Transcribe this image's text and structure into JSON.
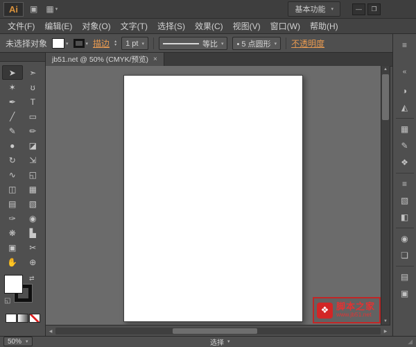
{
  "titlebar": {
    "app_logo": "Ai",
    "bridge_icon": "▣",
    "arrange_icon": "▦",
    "caret": "▾",
    "workspace_label": "基本功能",
    "minimize": "—",
    "restore": "❐"
  },
  "menubar": {
    "items": [
      "文件(F)",
      "编辑(E)",
      "对象(O)",
      "文字(T)",
      "选择(S)",
      "效果(C)",
      "视图(V)",
      "窗口(W)",
      "帮助(H)"
    ]
  },
  "controlbar": {
    "selection_status": "未选择对象",
    "caret": "▾",
    "stroke_link": "描边",
    "spin_up": "▴",
    "spin_down": "▾",
    "stroke_width": "1 pt",
    "profile_label": "等比",
    "brush_label": "• 5 点圆形",
    "opacity_link": "不透明度"
  },
  "tabbar": {
    "doc_title": "jb51.net @ 50% (CMYK/预览)",
    "close": "×"
  },
  "tools": [
    {
      "name": "selection",
      "glyph": "➤"
    },
    {
      "name": "direct-selection",
      "glyph": "➣"
    },
    {
      "name": "magic-wand",
      "glyph": "✶"
    },
    {
      "name": "lasso",
      "glyph": "ʊ"
    },
    {
      "name": "pen",
      "glyph": "✒"
    },
    {
      "name": "type",
      "glyph": "T"
    },
    {
      "name": "line-segment",
      "glyph": "╱"
    },
    {
      "name": "rectangle",
      "glyph": "▭"
    },
    {
      "name": "paintbrush",
      "glyph": "✎"
    },
    {
      "name": "pencil",
      "glyph": "✏"
    },
    {
      "name": "blob-brush",
      "glyph": "●"
    },
    {
      "name": "eraser",
      "glyph": "◪"
    },
    {
      "name": "rotate",
      "glyph": "↻"
    },
    {
      "name": "scale",
      "glyph": "⇲"
    },
    {
      "name": "width",
      "glyph": "∿"
    },
    {
      "name": "free-transform",
      "glyph": "◱"
    },
    {
      "name": "shape-builder",
      "glyph": "◫"
    },
    {
      "name": "perspective-grid",
      "glyph": "▦"
    },
    {
      "name": "mesh",
      "glyph": "▤"
    },
    {
      "name": "gradient",
      "glyph": "▧"
    },
    {
      "name": "eyedropper",
      "glyph": "✑"
    },
    {
      "name": "blend",
      "glyph": "◉"
    },
    {
      "name": "symbol-sprayer",
      "glyph": "❋"
    },
    {
      "name": "column-graph",
      "glyph": "▙"
    },
    {
      "name": "artboard",
      "glyph": "▣"
    },
    {
      "name": "slice",
      "glyph": "✂"
    },
    {
      "name": "hand",
      "glyph": "✋"
    },
    {
      "name": "zoom",
      "glyph": "⊕"
    }
  ],
  "swatches": {
    "swap": "⇄",
    "default": "◱"
  },
  "dock": {
    "panel_menu": "≡",
    "collapse": "«",
    "icons": [
      {
        "name": "color",
        "glyph": "◑"
      },
      {
        "name": "color-guide",
        "glyph": "◭"
      },
      {
        "name": "swatches",
        "glyph": "▦"
      },
      {
        "name": "brushes",
        "glyph": "✎"
      },
      {
        "name": "symbols",
        "glyph": "❖"
      },
      {
        "name": "stroke",
        "glyph": "≡"
      },
      {
        "name": "gradient",
        "glyph": "▧"
      },
      {
        "name": "transparency",
        "glyph": "◧"
      },
      {
        "name": "appearance",
        "glyph": "◉"
      },
      {
        "name": "graphic-styles",
        "glyph": "❏"
      },
      {
        "name": "layers",
        "glyph": "▤"
      },
      {
        "name": "artboards",
        "glyph": "▣"
      }
    ]
  },
  "scroll": {
    "up": "▲",
    "down": "▼",
    "left": "◀",
    "right": "▶"
  },
  "statusbar": {
    "zoom": "50%",
    "caret": "▾",
    "status": "选择",
    "grip": "◢"
  },
  "watermark": {
    "logo": "❖",
    "title": "脚本之家",
    "url": "www.jb51.net"
  },
  "colors": {
    "accent_orange": "#e89a50",
    "watermark_red": "#d22626",
    "panel_gray": "#4f4f4f",
    "canvas_gray": "#6b6b6b"
  }
}
